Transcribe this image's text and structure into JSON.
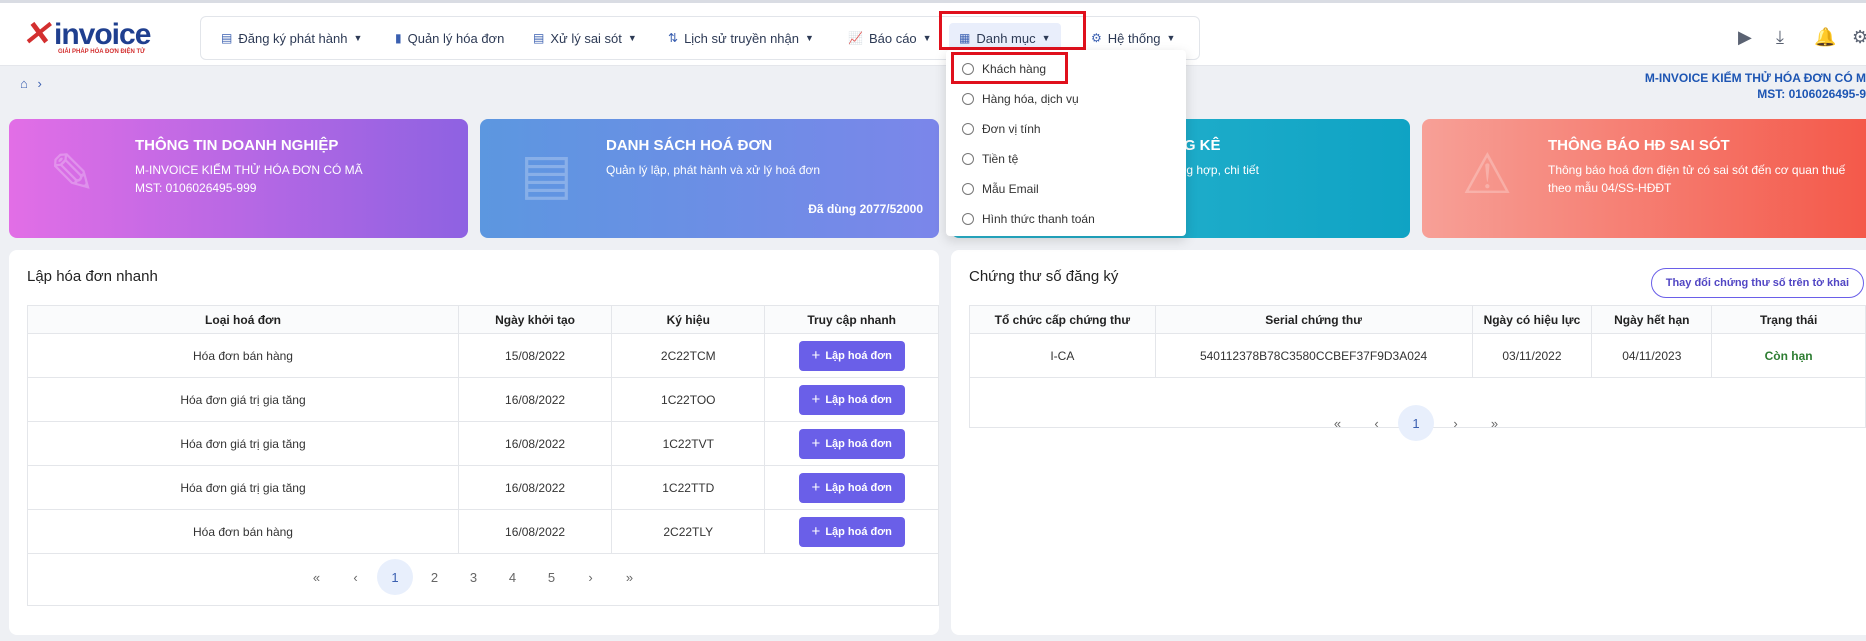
{
  "logo": {
    "word": "invoice",
    "tagline": "GIẢI PHÁP HÓA ĐƠN ĐIỆN TỬ"
  },
  "nav": [
    {
      "label": "Đăng ký phát hành",
      "icon": "file-register-icon",
      "chevron": true
    },
    {
      "label": "Quản lý hóa đơn",
      "icon": "file-icon",
      "chevron": false
    },
    {
      "label": "Xử lý sai sót",
      "icon": "file-error-icon",
      "chevron": true
    },
    {
      "label": "Lịch sử truyền nhận",
      "icon": "sort-arrows-icon",
      "chevron": true
    },
    {
      "label": "Báo cáo",
      "icon": "chart-line-icon",
      "chevron": true
    },
    {
      "label": "Danh mục",
      "icon": "grid-icon",
      "chevron": true
    },
    {
      "label": "Hệ thống",
      "icon": "gear-icon",
      "chevron": true
    }
  ],
  "dropdown": {
    "items": [
      "Khách hàng",
      "Hàng hóa, dịch vụ",
      "Đơn vị tính",
      "Tiền tệ",
      "Mẫu Email",
      "Hình thức thanh toán"
    ]
  },
  "company": {
    "name": "M-INVOICE KIỂM THỬ HÓA ĐƠN CÓ M",
    "mst": "MST: 0106026495-9"
  },
  "cards": [
    {
      "title": "THÔNG TIN DOANH NGHIỆP",
      "lines": [
        "M-INVOICE KIỂM THỬ HÓA ĐƠN CÓ MÃ",
        "MST: 0106026495-999"
      ],
      "color": "#c868e8"
    },
    {
      "title": "DANH SÁCH HOÁ ĐƠN",
      "lines": [
        "Quản lý lập, phát hành và xử lý hoá đơn"
      ],
      "used": "Đã dùng 2077/52000",
      "color": "#6f8ee8"
    },
    {
      "title": "NG KÊ",
      "lines": [
        "ổng hợp, chi tiết"
      ],
      "color": "#12a9c6"
    },
    {
      "title": "THÔNG BÁO HĐ SAI SÓT",
      "lines": [
        "Thông báo hoá đơn điện tử có sai sót đến cơ quan thuế",
        "theo mẫu 04/SS-HĐĐT"
      ],
      "color": "#f46a5c"
    }
  ],
  "quick": {
    "title": "Lập hóa đơn nhanh",
    "headers": [
      "Loại hoá đơn",
      "Ngày khởi tạo",
      "Ký hiệu",
      "Truy cập nhanh"
    ],
    "button_label": "Lập hoá đơn",
    "rows": [
      [
        "Hóa đơn bán hàng",
        "15/08/2022",
        "2C22TCM"
      ],
      [
        "Hóa đơn giá trị gia tăng",
        "16/08/2022",
        "1C22TOO"
      ],
      [
        "Hóa đơn giá trị gia tăng",
        "16/08/2022",
        "1C22TVT"
      ],
      [
        "Hóa đơn giá trị gia tăng",
        "16/08/2022",
        "1C22TTD"
      ],
      [
        "Hóa đơn bán hàng",
        "16/08/2022",
        "2C22TLY"
      ]
    ],
    "pager": {
      "first": "«",
      "prev": "‹",
      "pages": [
        "1",
        "2",
        "3",
        "4",
        "5"
      ],
      "current": "1",
      "next": "›",
      "last": "»"
    }
  },
  "cert": {
    "title": "Chứng thư số đăng ký",
    "button": "Thay đổi chứng thư số trên tờ khai",
    "headers": [
      "Tổ chức cấp chứng thư",
      "Serial chứng thư",
      "Ngày có hiệu lực",
      "Ngày hết hạn",
      "Trạng thái"
    ],
    "rows": [
      [
        "I-CA",
        "540112378B78C3580CCBEF37F9D3A024",
        "03/11/2022",
        "04/11/2023",
        "Còn hạn"
      ]
    ],
    "pager": {
      "first": "«",
      "prev": "‹",
      "current": "1",
      "next": "›",
      "last": "»"
    }
  }
}
